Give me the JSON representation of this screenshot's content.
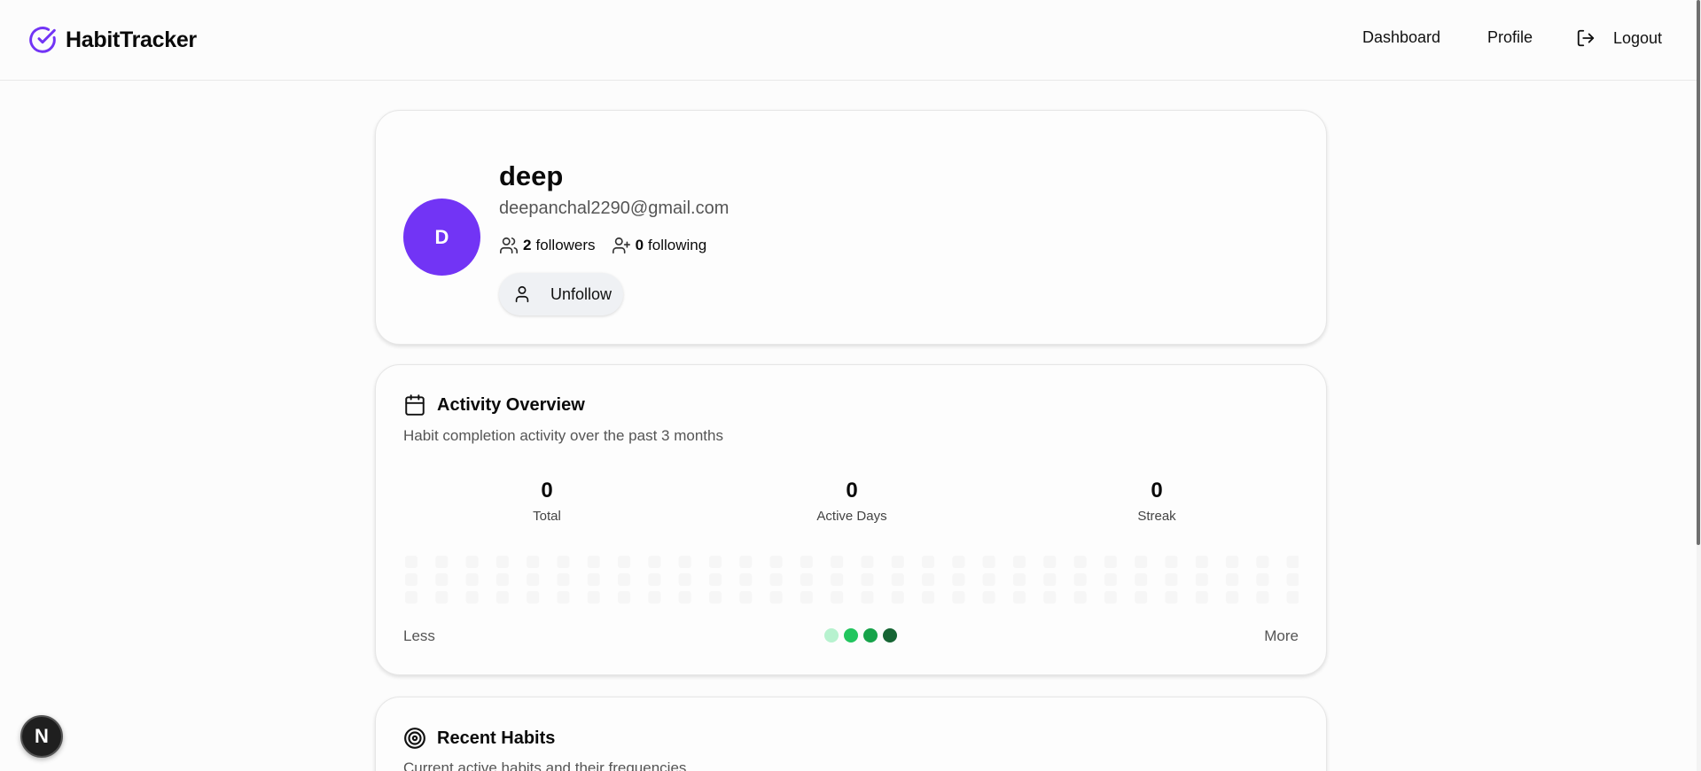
{
  "header": {
    "brand": "HabitTracker",
    "nav": {
      "dashboard": "Dashboard",
      "profile": "Profile",
      "logout": "Logout"
    }
  },
  "profile": {
    "avatar_initial": "D",
    "username": "deep",
    "email": "deepanchal2290@gmail.com",
    "followers_count": "2",
    "followers_label": "followers",
    "following_count": "0",
    "following_label": "following",
    "unfollow_label": "Unfollow",
    "avatar_color": "#7234f5"
  },
  "activity": {
    "title": "Activity Overview",
    "description": "Habit completion activity over the past 3 months",
    "stats": [
      {
        "value": "0",
        "label": "Total"
      },
      {
        "value": "0",
        "label": "Active Days"
      },
      {
        "value": "0",
        "label": "Streak"
      }
    ],
    "legend_less": "Less",
    "legend_more": "More",
    "legend_colors": [
      "#b7f2cf",
      "#22c55e",
      "#16a34a",
      "#166534"
    ]
  },
  "habits": {
    "title": "Recent Habits",
    "description": "Current active habits and their frequencies"
  },
  "badge": {
    "label": "N"
  }
}
